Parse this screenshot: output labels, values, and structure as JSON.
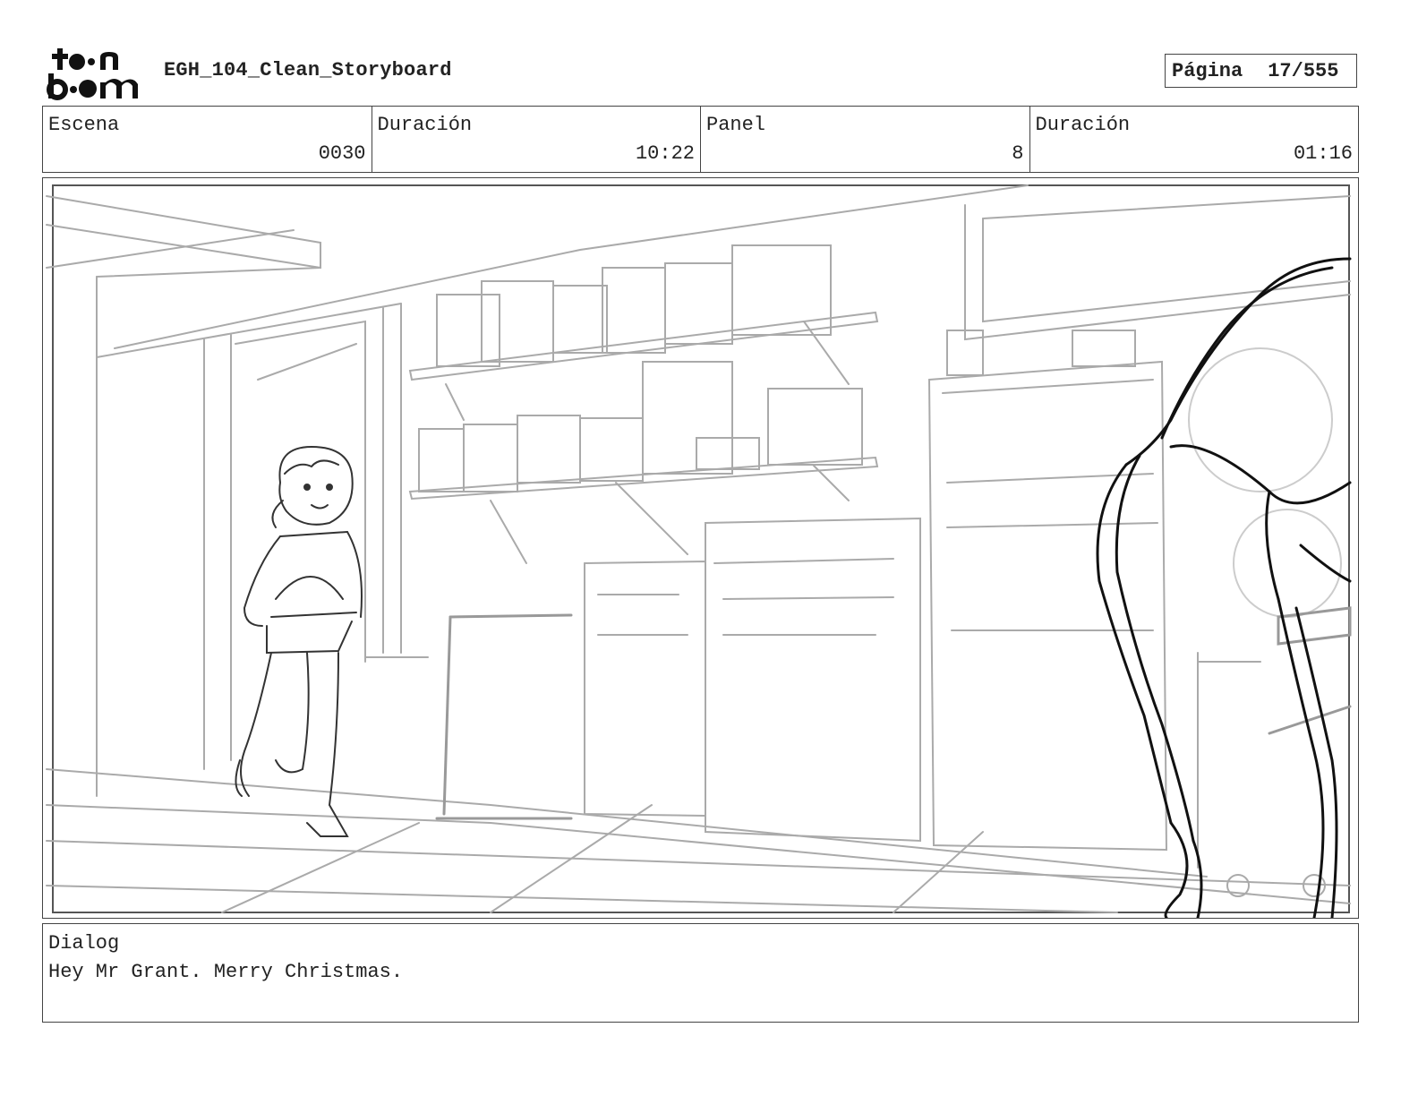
{
  "header": {
    "brand": "toon boom",
    "title": "EGH_104_Clean_Storyboard",
    "page_label": "Página",
    "page_value": "17/555"
  },
  "info": {
    "scene_label": "Escena",
    "scene_value": "0030",
    "scene_duration_label": "Duración",
    "scene_duration_value": "10:22",
    "panel_label": "Panel",
    "panel_value": "8",
    "panel_duration_label": "Duración",
    "panel_duration_value": "01:16"
  },
  "dialog": {
    "label": "Dialog",
    "text": "Hey Mr Grant. Merry Christmas."
  }
}
